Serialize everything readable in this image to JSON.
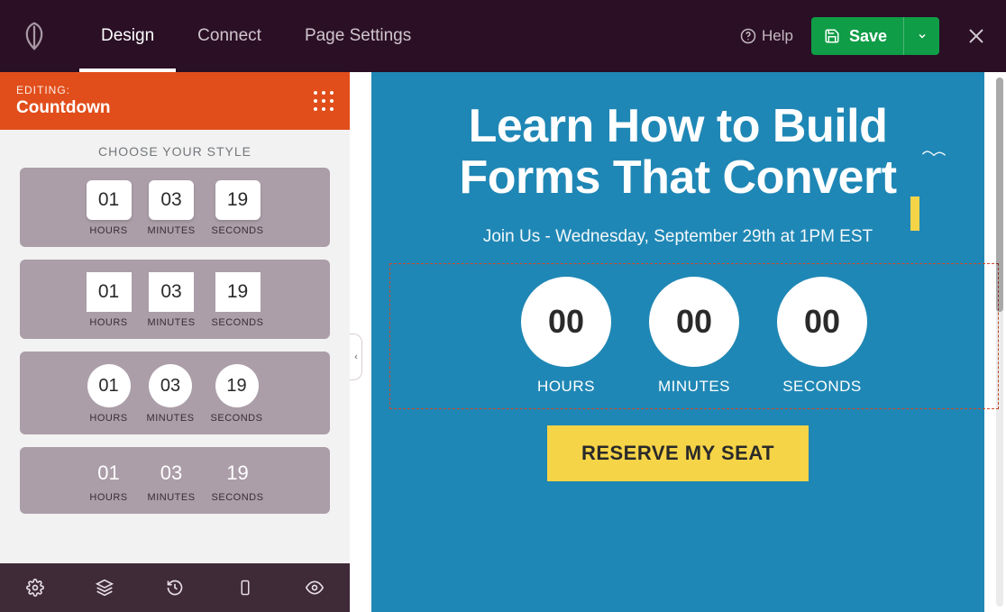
{
  "topbar": {
    "tabs": {
      "design": "Design",
      "connect": "Connect",
      "page_settings": "Page Settings"
    },
    "help": "Help",
    "save": "Save"
  },
  "panel": {
    "kicker": "EDITING:",
    "title": "Countdown",
    "choose_label": "CHOOSE YOUR STYLE",
    "styles": [
      {
        "hours": "01",
        "minutes": "03",
        "seconds": "19"
      },
      {
        "hours": "01",
        "minutes": "03",
        "seconds": "19"
      },
      {
        "hours": "01",
        "minutes": "03",
        "seconds": "19"
      },
      {
        "hours": "01",
        "minutes": "03",
        "seconds": "19"
      }
    ],
    "unit_labels": {
      "hours": "HOURS",
      "minutes": "MINUTES",
      "seconds": "SECONDS"
    }
  },
  "canvas": {
    "headline_l1": "Learn How to Build",
    "headline_l2": "Forms That Convert",
    "sub": "Join Us - Wednesday, September 29th at 1PM EST",
    "countdown": {
      "hours": "00",
      "minutes": "00",
      "seconds": "00"
    },
    "labels": {
      "hours": "HOURS",
      "minutes": "MINUTES",
      "seconds": "SECONDS"
    },
    "cta": "RESERVE MY SEAT"
  }
}
